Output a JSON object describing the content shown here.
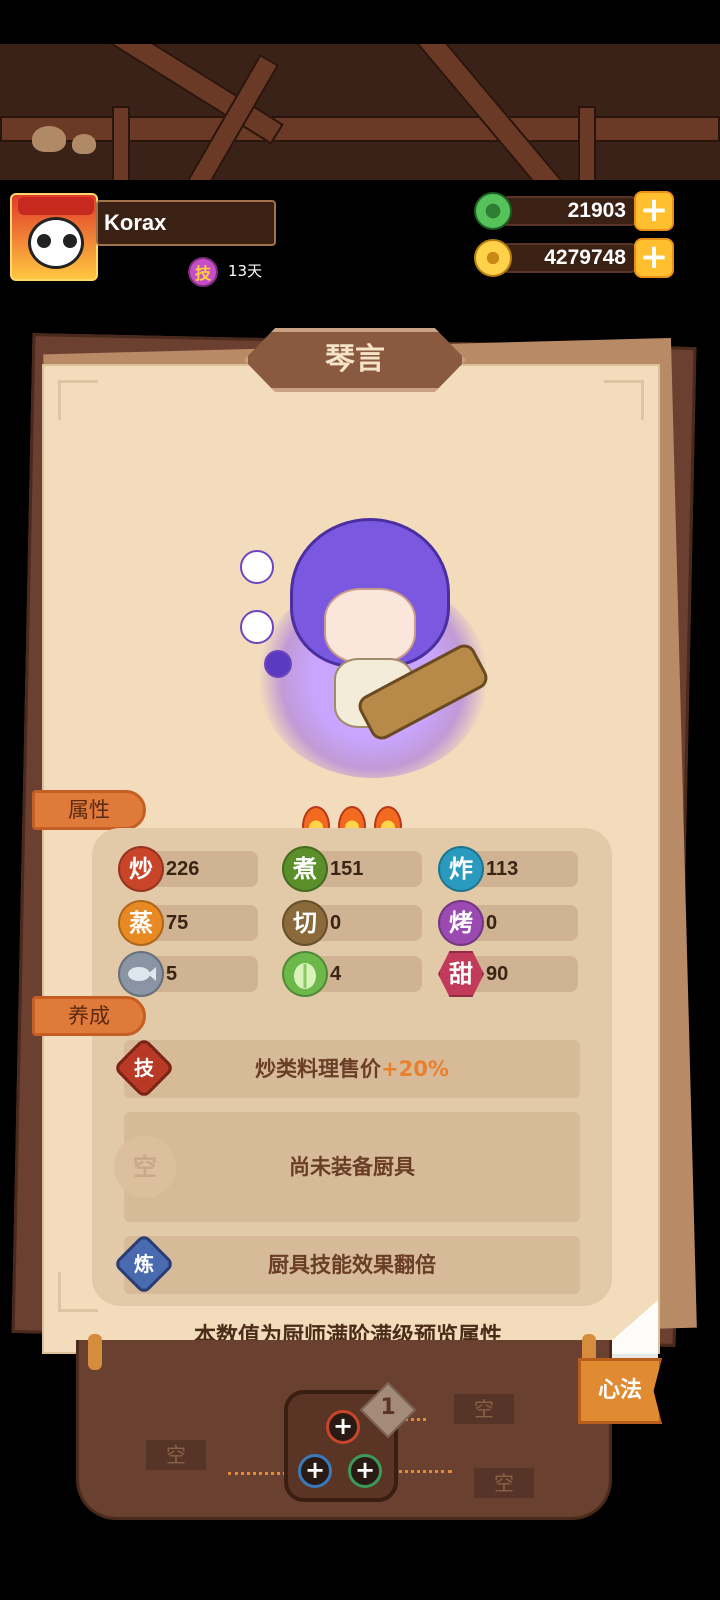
{
  "header": {
    "player_name": "Korax",
    "skill_badge": "技",
    "days": "13天",
    "currencies": [
      {
        "icon": "jade-icon",
        "amount": "21903",
        "plus": "+"
      },
      {
        "icon": "coin-icon",
        "amount": "4279748",
        "plus": "+"
      }
    ]
  },
  "chef": {
    "name": "琴言",
    "rarity_flames": 3
  },
  "sections": {
    "attributes_label": "属性",
    "cultivation_label": "养成"
  },
  "stats": [
    {
      "glyph": "炒",
      "value": "226",
      "color": "#c8452a"
    },
    {
      "glyph": "煮",
      "value": "151",
      "color": "#5b8f2a"
    },
    {
      "glyph": "炸",
      "value": "113",
      "color": "#2a9bbf"
    },
    {
      "glyph": "蒸",
      "value": "75",
      "color": "#e88a24"
    },
    {
      "glyph": "切",
      "value": "0",
      "color": "#8a6a3a"
    },
    {
      "glyph": "烤",
      "value": "0",
      "color": "#9a4ab0"
    },
    {
      "glyph": "",
      "value": "5",
      "color": "#8a94a4"
    },
    {
      "glyph": "",
      "value": "4",
      "color": "#6cb84a"
    },
    {
      "glyph": "甜",
      "value": "90",
      "color": "#c23a5a"
    }
  ],
  "cultivation": {
    "skill": {
      "icon": "技",
      "text": "炒类料理售价",
      "bonus": "+20%"
    },
    "equipment": {
      "icon": "空",
      "text": "尚未装备厨具"
    },
    "refine": {
      "icon": "炼",
      "text": "厨具技能效果翻倍"
    }
  },
  "footer_note": "本数值为厨师满阶满级预览属性",
  "bottom": {
    "level": "1",
    "empty_slots": [
      "空",
      "空",
      "空"
    ],
    "xinfa_button": "心法",
    "node_symbol": "+"
  }
}
